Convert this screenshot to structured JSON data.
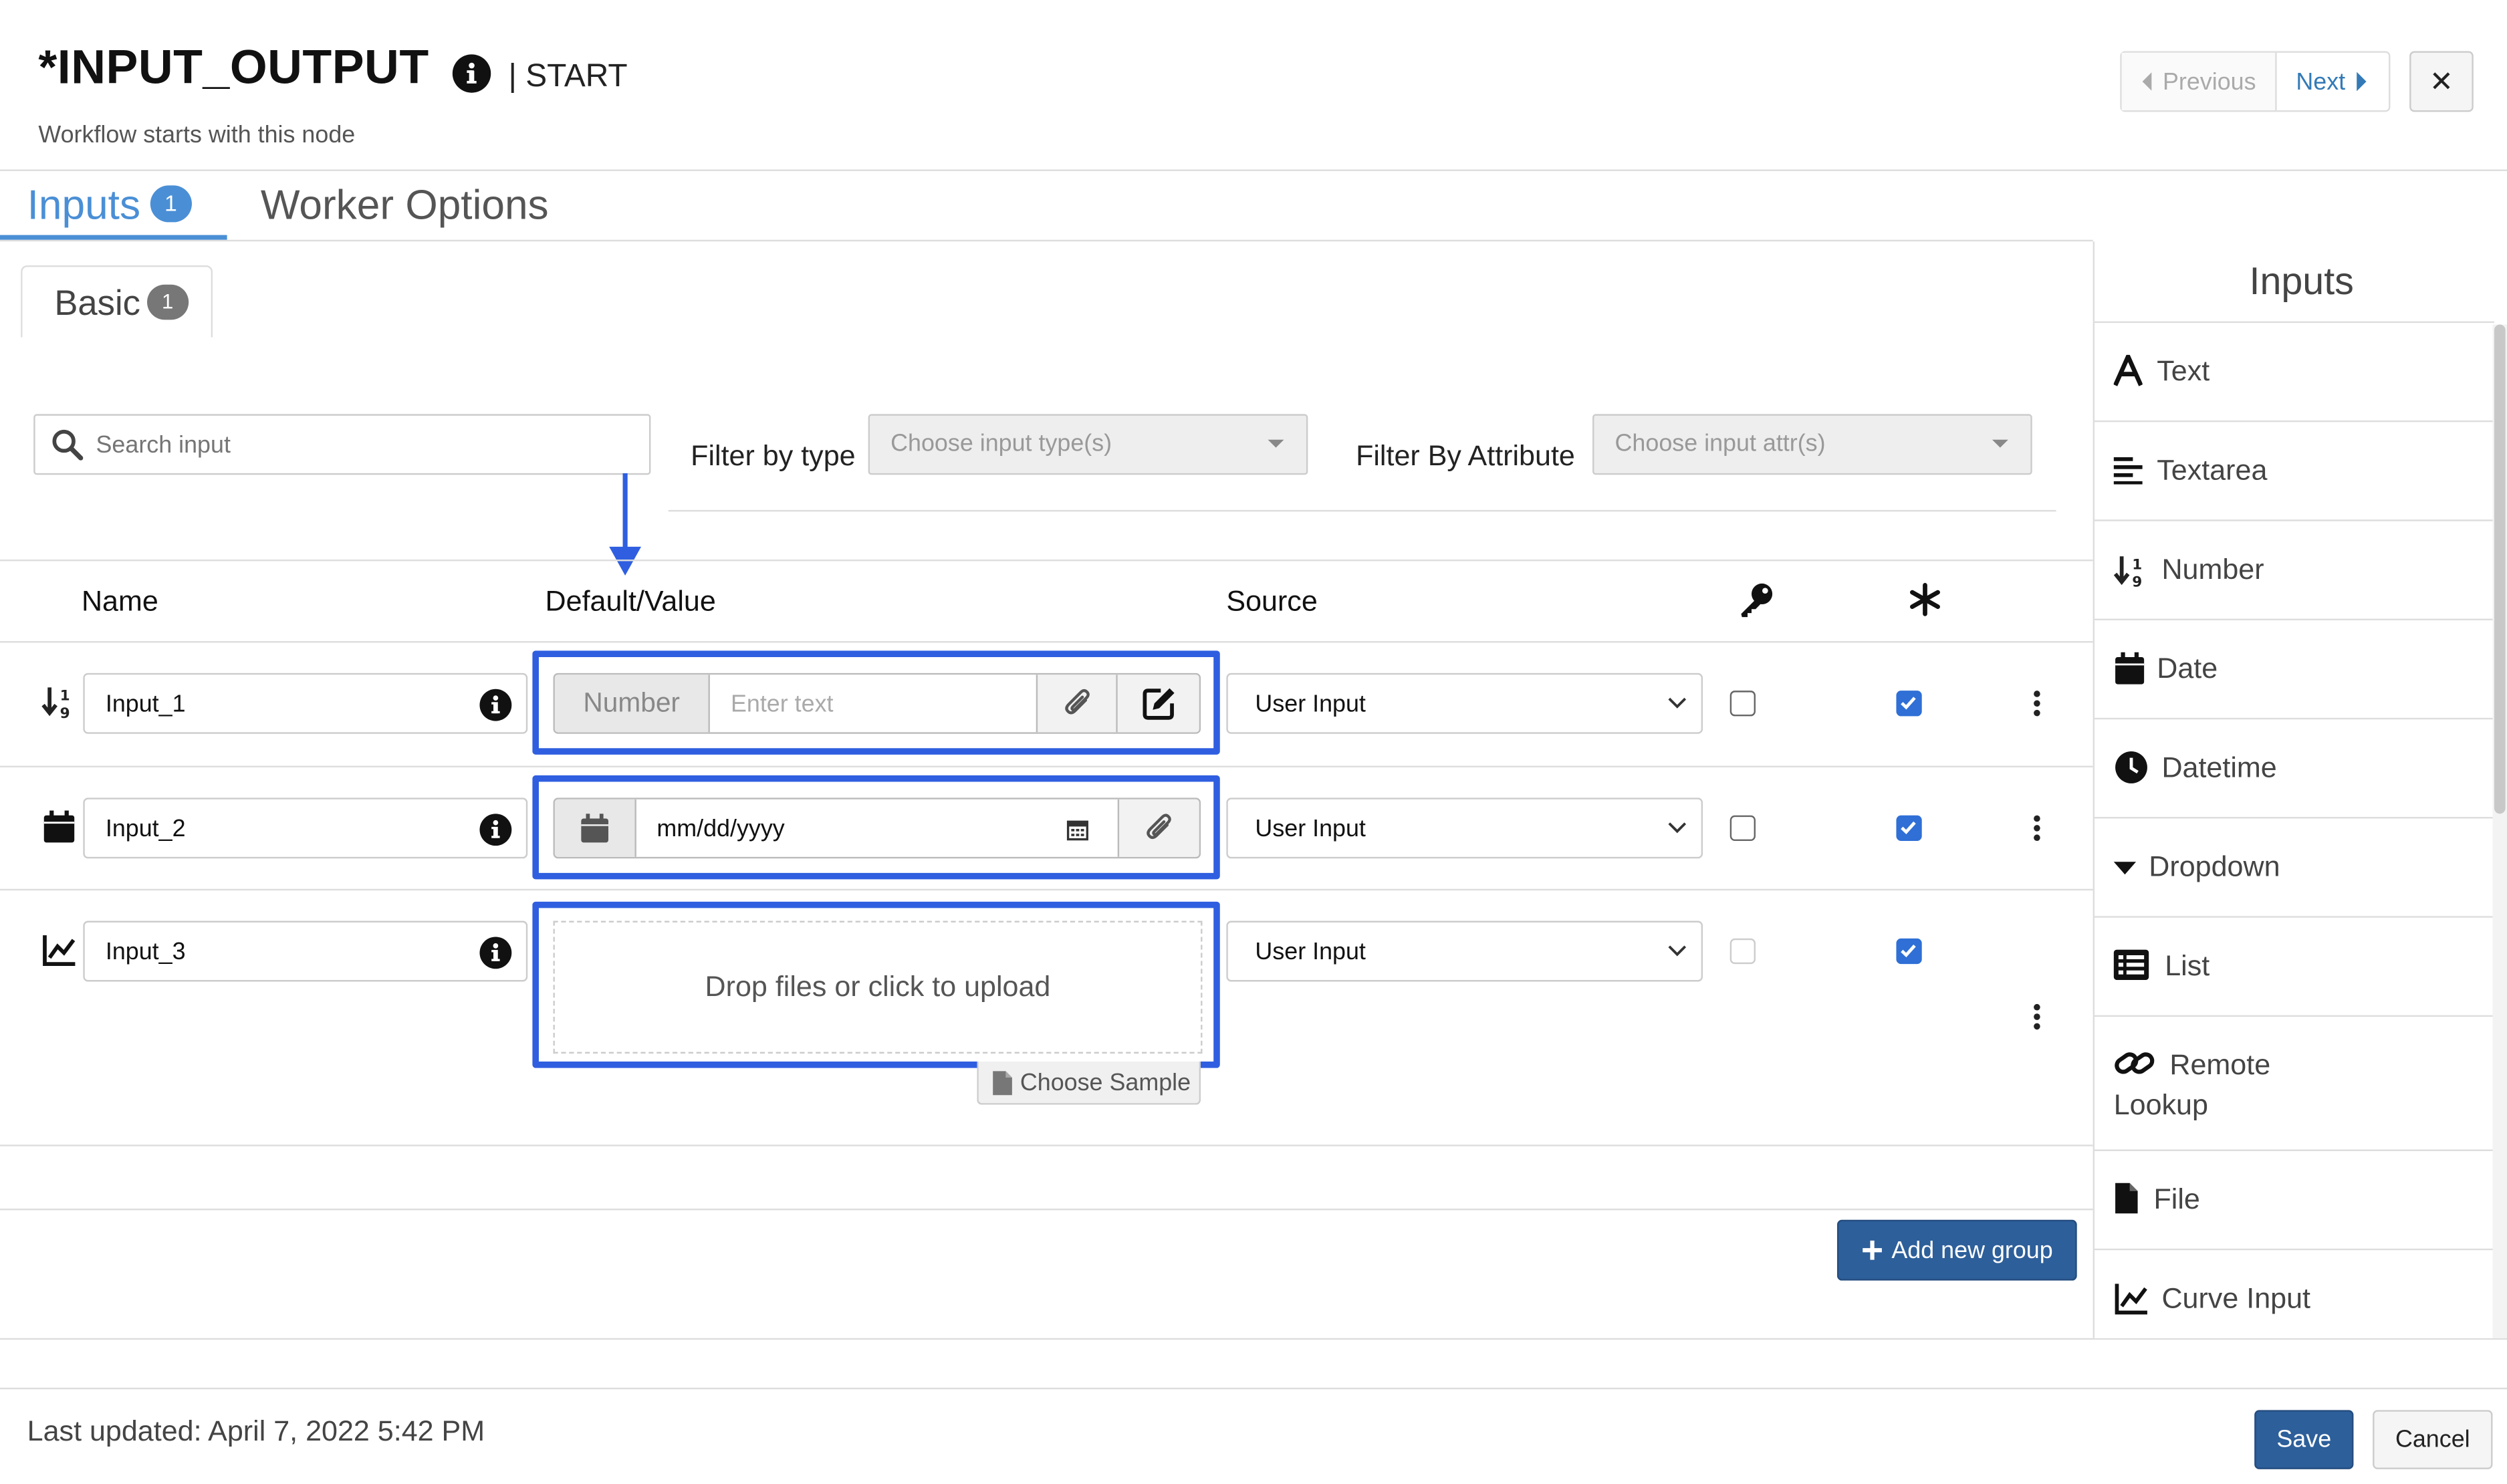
{
  "header": {
    "title": "*INPUT_OUTPUT",
    "subtitle": "| START",
    "description": "Workflow starts with this node",
    "prev_label": "Previous",
    "next_label": "Next",
    "close_label": "✕"
  },
  "tabs": [
    {
      "label": "Inputs",
      "badge": "1",
      "active": true
    },
    {
      "label": "Worker Options",
      "active": false
    }
  ],
  "subtab": {
    "label": "Basic",
    "badge": "1"
  },
  "filters": {
    "search_placeholder": "Search input",
    "type_label": "Filter by type",
    "type_placeholder": "Choose input type(s)",
    "attr_label": "Filter By Attribute",
    "attr_placeholder": "Choose input attr(s)"
  },
  "columns": {
    "name": "Name",
    "default": "Default/Value",
    "source": "Source"
  },
  "rows": [
    {
      "icon": "number-sort-icon",
      "name": "Input_1",
      "addon": "Number",
      "value_placeholder": "Enter text",
      "source": "User Input",
      "key_checked": false,
      "required_checked": true
    },
    {
      "icon": "calendar-icon",
      "name": "Input_2",
      "value": "mm/dd/yyyy",
      "source": "User Input",
      "key_checked": false,
      "required_checked": true
    },
    {
      "icon": "chart-line-icon",
      "name": "Input_3",
      "drop_text": "Drop files or click to upload",
      "sample_label": "Choose Sample",
      "source": "User Input",
      "key_checked": false,
      "required_checked": true
    }
  ],
  "add_group_label": "Add new group",
  "panel": {
    "title": "Inputs",
    "items": [
      {
        "label": "Text",
        "icon": "text-icon"
      },
      {
        "label": "Textarea",
        "icon": "align-left-icon"
      },
      {
        "label": "Number",
        "icon": "number-sort-icon"
      },
      {
        "label": "Date",
        "icon": "calendar-icon"
      },
      {
        "label": "Datetime",
        "icon": "clock-icon"
      },
      {
        "label": "Dropdown",
        "icon": "caret-down-icon"
      },
      {
        "label": "List",
        "icon": "list-icon"
      },
      {
        "label": "Remote",
        "label2": "Lookup",
        "icon": "link-icon"
      },
      {
        "label": "File",
        "icon": "file-icon"
      },
      {
        "label": "Curve Input",
        "icon": "chart-line-icon"
      }
    ]
  },
  "footer": {
    "updated": "Last updated: April 7, 2022 5:42 PM",
    "save_label": "Save",
    "cancel_label": "Cancel"
  },
  "colors": {
    "accent": "#4a8fd6",
    "primary_button": "#2d5f9a",
    "highlight_box": "#2f5fe0"
  }
}
